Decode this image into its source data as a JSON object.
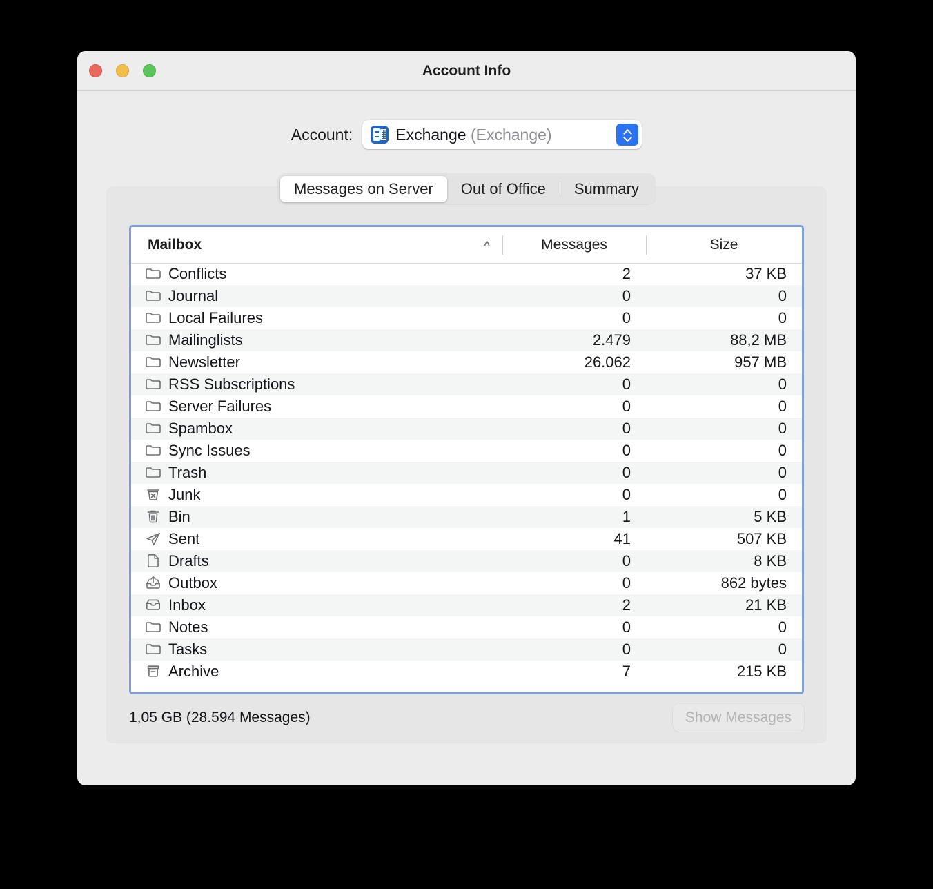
{
  "window": {
    "title": "Account Info",
    "traffic_lights": [
      "close-button",
      "minimize-button",
      "zoom-button"
    ]
  },
  "account": {
    "label": "Account:",
    "selected_name": "Exchange",
    "selected_type": "(Exchange)",
    "icon": "exchange-icon"
  },
  "tabs": [
    {
      "label": "Messages on Server",
      "active": true
    },
    {
      "label": "Out of Office",
      "active": false
    },
    {
      "label": "Summary",
      "active": false
    }
  ],
  "table": {
    "columns": [
      {
        "key": "mailbox",
        "label": "Mailbox",
        "sorted": true,
        "sort_direction": "ascending",
        "sort_glyph": "^"
      },
      {
        "key": "messages",
        "label": "Messages"
      },
      {
        "key": "size",
        "label": "Size"
      }
    ],
    "rows": [
      {
        "icon": "folder-icon",
        "name": "Conflicts",
        "messages": "2",
        "size": "37 KB"
      },
      {
        "icon": "folder-icon",
        "name": "Journal",
        "messages": "0",
        "size": "0"
      },
      {
        "icon": "folder-icon",
        "name": "Local Failures",
        "messages": "0",
        "size": "0"
      },
      {
        "icon": "folder-icon",
        "name": "Mailinglists",
        "messages": "2.479",
        "size": "88,2 MB"
      },
      {
        "icon": "folder-icon",
        "name": "Newsletter",
        "messages": "26.062",
        "size": "957 MB"
      },
      {
        "icon": "folder-icon",
        "name": "RSS Subscriptions",
        "messages": "0",
        "size": "0"
      },
      {
        "icon": "folder-icon",
        "name": "Server Failures",
        "messages": "0",
        "size": "0"
      },
      {
        "icon": "folder-icon",
        "name": "Spambox",
        "messages": "0",
        "size": "0"
      },
      {
        "icon": "folder-icon",
        "name": "Sync Issues",
        "messages": "0",
        "size": "0"
      },
      {
        "icon": "folder-icon",
        "name": "Trash",
        "messages": "0",
        "size": "0"
      },
      {
        "icon": "junk-icon",
        "name": "Junk",
        "messages": "0",
        "size": "0"
      },
      {
        "icon": "trash-icon",
        "name": "Bin",
        "messages": "1",
        "size": "5 KB"
      },
      {
        "icon": "sent-icon",
        "name": "Sent",
        "messages": "41",
        "size": "507 KB"
      },
      {
        "icon": "drafts-icon",
        "name": "Drafts",
        "messages": "0",
        "size": "8 KB"
      },
      {
        "icon": "outbox-icon",
        "name": "Outbox",
        "messages": "0",
        "size": "862 bytes"
      },
      {
        "icon": "inbox-icon",
        "name": "Inbox",
        "messages": "2",
        "size": "21 KB"
      },
      {
        "icon": "folder-icon",
        "name": "Notes",
        "messages": "0",
        "size": "0"
      },
      {
        "icon": "folder-icon",
        "name": "Tasks",
        "messages": "0",
        "size": "0"
      },
      {
        "icon": "archive-icon",
        "name": "Archive",
        "messages": "7",
        "size": "215 KB"
      }
    ]
  },
  "footer": {
    "total": "1,05 GB (28.594 Messages)",
    "show_messages_label": "Show Messages",
    "show_messages_enabled": false
  },
  "colors": {
    "focus_ring": "#7f9ee0",
    "accent_blue": "#2b72ee",
    "exchange_blue": "#2565bd",
    "window_bg": "#ececec",
    "panel_bg": "#e6e6e6",
    "row_alt": "#f4f5f5"
  }
}
